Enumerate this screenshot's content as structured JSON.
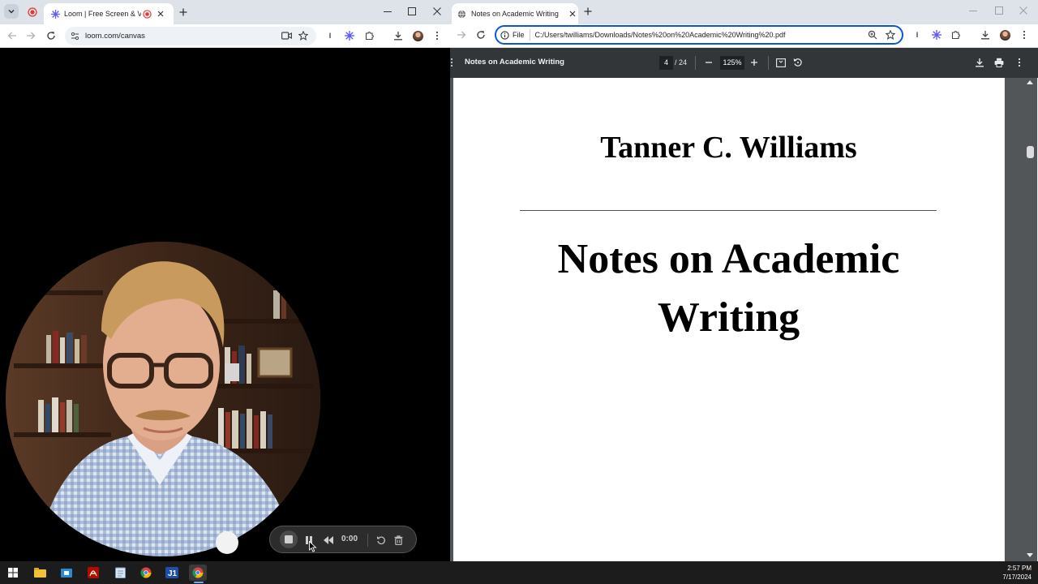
{
  "left_browser": {
    "tab_active_title": "Loom | Free Screen & Video",
    "url": "loom.com/canvas"
  },
  "loom_controls": {
    "timer": "0:00"
  },
  "right_browser": {
    "tab_title": "Notes on Academic Writing",
    "url_prefix": "File",
    "url": "C:/Users/twilliams/Downloads/Notes%20on%20Academic%20Writing%20.pdf",
    "pdf_toolbar": {
      "doc_title": "Notes on Academic Writing",
      "page_current": "4",
      "page_total": "/ 24",
      "zoom": "125%"
    },
    "pdf_page": {
      "author": "Tanner C. Williams",
      "title_line1": "Notes on Academic",
      "title_line2": "Writing"
    }
  },
  "taskbar": {
    "time": "2:57 PM",
    "date": "7/17/2024",
    "apps": [
      "windows-start",
      "file-explorer",
      "store",
      "acrobat",
      "notepad",
      "chrome",
      "jupyter",
      "chrome-active"
    ]
  },
  "colors": {
    "tabstrip": "#dee3ea",
    "pdf_toolbar": "#323639",
    "pdf_background": "#525659",
    "omnibox_focus": "#0b57d0",
    "loom_record_red": "#e2393a"
  }
}
